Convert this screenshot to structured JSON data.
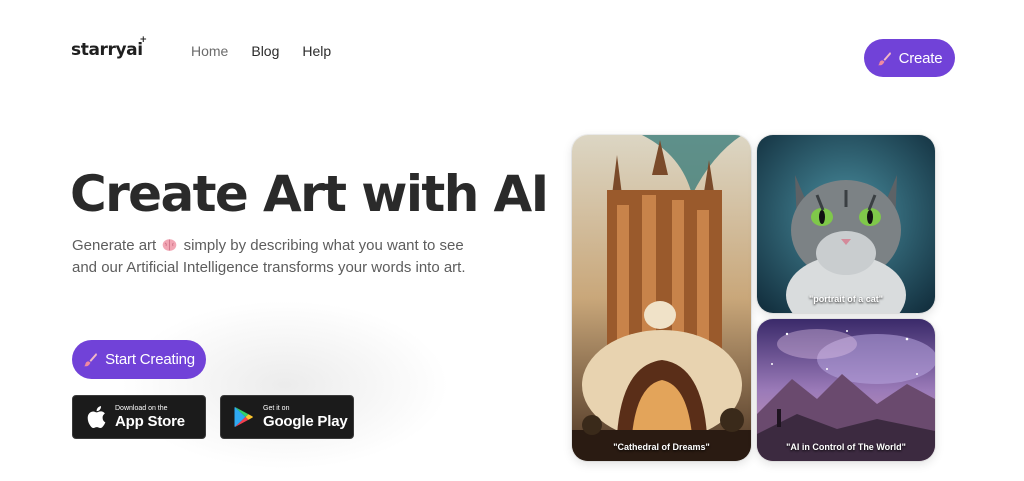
{
  "brand": {
    "name": "starryai",
    "spark": "+"
  },
  "nav": {
    "items": [
      "Home",
      "Blog",
      "Help"
    ]
  },
  "header": {
    "create_label": "Create"
  },
  "hero": {
    "title": "Create Art with AI",
    "subtitle_part1": "Generate art",
    "subtitle_part2": "simply by describing what you want to see and our Artificial Intelligence transforms your words into art.",
    "cta_label": "Start Creating"
  },
  "stores": {
    "apple": {
      "small": "Download on the",
      "big": "App Store"
    },
    "google": {
      "small": "Get it on",
      "big": "Google Play"
    }
  },
  "gallery": {
    "items": [
      {
        "caption": "\"Cathedral of Dreams\""
      },
      {
        "caption": "\"portrait of a cat\""
      },
      {
        "caption": "\"AI in Control of The World\""
      }
    ]
  },
  "colors": {
    "accent": "#7142d8",
    "store_bg": "#1b1b1b",
    "text": "#2a2a2a"
  }
}
